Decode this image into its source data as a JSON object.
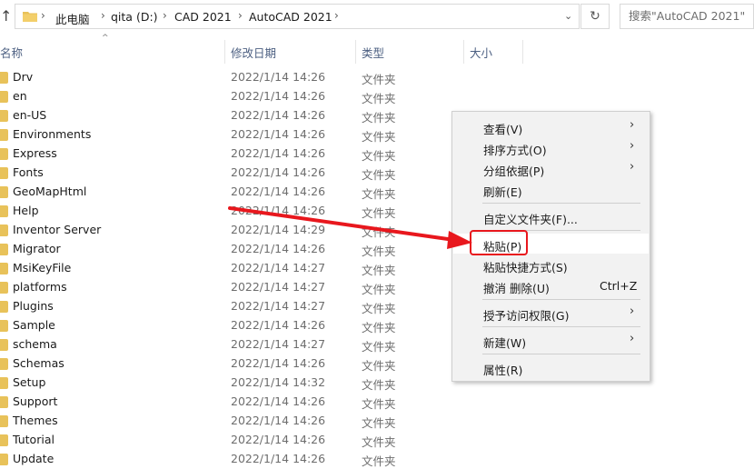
{
  "address": {
    "crumbs": [
      "此电脑",
      "qita (D:)",
      "CAD 2021",
      "AutoCAD 2021"
    ]
  },
  "search": {
    "placeholder": "搜索\"AutoCAD 2021\""
  },
  "columns": {
    "name": "名称",
    "date": "修改日期",
    "type": "类型",
    "size": "大小"
  },
  "files": [
    {
      "name": "Drv",
      "date": "2022/1/14 14:26",
      "type": "文件夹"
    },
    {
      "name": "en",
      "date": "2022/1/14 14:26",
      "type": "文件夹"
    },
    {
      "name": "en-US",
      "date": "2022/1/14 14:26",
      "type": "文件夹"
    },
    {
      "name": "Environments",
      "date": "2022/1/14 14:26",
      "type": "文件夹"
    },
    {
      "name": "Express",
      "date": "2022/1/14 14:26",
      "type": "文件夹"
    },
    {
      "name": "Fonts",
      "date": "2022/1/14 14:26",
      "type": "文件夹"
    },
    {
      "name": "GeoMapHtml",
      "date": "2022/1/14 14:26",
      "type": "文件夹"
    },
    {
      "name": "Help",
      "date": "2022/1/14 14:26",
      "type": "文件夹"
    },
    {
      "name": "Inventor Server",
      "date": "2022/1/14 14:29",
      "type": "文件夹"
    },
    {
      "name": "Migrator",
      "date": "2022/1/14 14:26",
      "type": "文件夹"
    },
    {
      "name": "MsiKeyFile",
      "date": "2022/1/14 14:27",
      "type": "文件夹"
    },
    {
      "name": "platforms",
      "date": "2022/1/14 14:27",
      "type": "文件夹"
    },
    {
      "name": "Plugins",
      "date": "2022/1/14 14:27",
      "type": "文件夹"
    },
    {
      "name": "Sample",
      "date": "2022/1/14 14:26",
      "type": "文件夹"
    },
    {
      "name": "schema",
      "date": "2022/1/14 14:27",
      "type": "文件夹"
    },
    {
      "name": "Schemas",
      "date": "2022/1/14 14:26",
      "type": "文件夹"
    },
    {
      "name": "Setup",
      "date": "2022/1/14 14:32",
      "type": "文件夹"
    },
    {
      "name": "Support",
      "date": "2022/1/14 14:26",
      "type": "文件夹"
    },
    {
      "name": "Themes",
      "date": "2022/1/14 14:26",
      "type": "文件夹"
    },
    {
      "name": "Tutorial",
      "date": "2022/1/14 14:26",
      "type": "文件夹"
    },
    {
      "name": "Update",
      "date": "2022/1/14 14:26",
      "type": "文件夹"
    }
  ],
  "context_menu": {
    "view": "查看(V)",
    "sort": "排序方式(O)",
    "group": "分组依据(P)",
    "refresh": "刷新(E)",
    "customize": "自定义文件夹(F)...",
    "paste": "粘贴(P)",
    "paste_shortcut": "粘贴快捷方式(S)",
    "undo": "撤消 删除(U)",
    "undo_accel": "Ctrl+Z",
    "access": "授予访问权限(G)",
    "new": "新建(W)",
    "properties": "属性(R)"
  },
  "colors": {
    "annotation": "#e8171d",
    "folder": "#e8c25a",
    "header_text": "#4d6082"
  },
  "icons": [
    "up-arrow-icon",
    "folder-icon",
    "chevron-right-icon",
    "chevron-down-icon",
    "refresh-icon"
  ]
}
